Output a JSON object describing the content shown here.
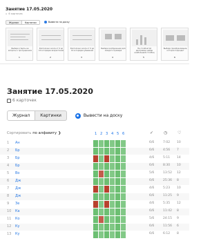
{
  "thumb": {
    "title": "Занятие 17.05.2020",
    "subtitle": "6 карточек",
    "tabs": [
      "Журнал",
      "Картинки"
    ],
    "broadcast": "Вывести на доску",
    "cards": [
      {
        "caption": "Выбери ответы на вопросы о пропущенном",
        "num": "1"
      },
      {
        "caption": "Расположи числа от 0 до 10 в порядке возрастания",
        "num": "2"
      },
      {
        "caption": "Расположи числа от 0 до 10 в порядке убывания",
        "num": "3"
      },
      {
        "caption": "Выбери изображения для каждого примера",
        "num": "4"
      },
      {
        "caption": "На столбчатой диаграмме найди наибольший столбец",
        "num": "5"
      },
      {
        "caption": "Выбери преобразование, которое подходит",
        "num": "6"
      }
    ]
  },
  "main": {
    "title": "Занятие 17.05.2020",
    "subtitle": "6 карточек",
    "tab_journal": "Журнал",
    "tab_pictures": "Картинки",
    "broadcast": "Вывести на доску",
    "sort_prefix": "Сортировать",
    "sort_value": "по алфавиту",
    "columns": [
      "1",
      "2",
      "3",
      "4",
      "5",
      "6"
    ],
    "icons": {
      "check": "check-icon",
      "clock": "clock-icon",
      "heart": "heart-icon"
    }
  },
  "rows": [
    {
      "n": "1",
      "name": "Ан",
      "score": "6/6",
      "time": "7:02",
      "cnt": "10"
    },
    {
      "n": "2",
      "name": "Бр",
      "score": "6/6",
      "time": "4:56",
      "cnt": "7"
    },
    {
      "n": "3",
      "name": "Бр",
      "score": "4/6",
      "time": "5:11",
      "cnt": "14"
    },
    {
      "n": "4",
      "name": "Бр",
      "score": "6/6",
      "time": "8:30",
      "cnt": "10"
    },
    {
      "n": "5",
      "name": "Во",
      "score": "5/6",
      "time": "13:52",
      "cnt": "12"
    },
    {
      "n": "6",
      "name": "Дж",
      "score": "6/6",
      "time": "25:36",
      "cnt": "8"
    },
    {
      "n": "7",
      "name": "Дж",
      "score": "4/6",
      "time": "5:23",
      "cnt": "10"
    },
    {
      "n": "8",
      "name": "Дж",
      "score": "6/6",
      "time": "11:25",
      "cnt": "9"
    },
    {
      "n": "9",
      "name": "Зе",
      "score": "4/6",
      "time": "5:35",
      "cnt": "12"
    },
    {
      "n": "10",
      "name": "Ка",
      "score": "6/6",
      "time": "11:42",
      "cnt": "8"
    },
    {
      "n": "11",
      "name": "Ко",
      "score": "5/6",
      "time": "24:15",
      "cnt": "9"
    },
    {
      "n": "12",
      "name": "Ку",
      "score": "6/6",
      "time": "11:56",
      "cnt": "6"
    },
    {
      "n": "13",
      "name": "Ку",
      "score": "6/6",
      "time": "6:12",
      "cnt": "8"
    }
  ],
  "colors": {
    "accent": "#1a73e8",
    "good": "#6cbf72",
    "bad": "#b7412e",
    "warn": "#d7d24a"
  }
}
